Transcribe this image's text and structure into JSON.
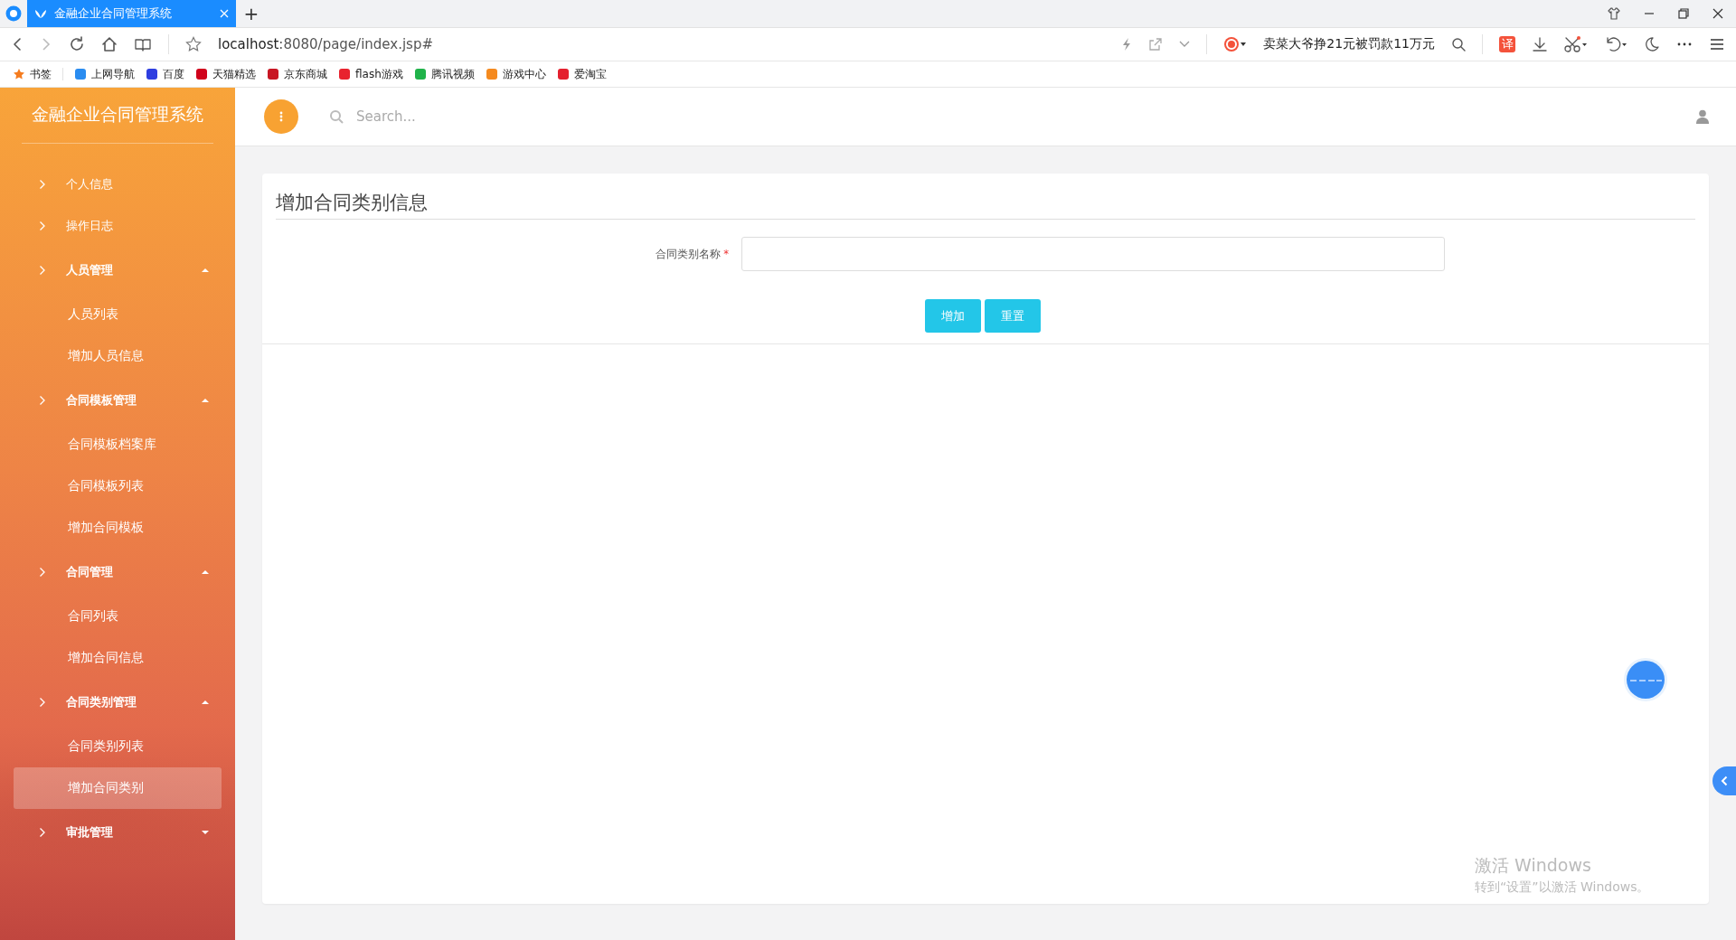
{
  "browser": {
    "tab": {
      "title": "金融企业合同管理系统",
      "selected": true
    },
    "new_tab": "+",
    "address": {
      "host": "localhost",
      "path": ":8080/page/index.jsp#"
    },
    "news": "卖菜大爷挣21元被罚款11万元",
    "translate": "译",
    "bookmarks": [
      {
        "label": "书签",
        "color": "#f57c1f"
      },
      {
        "label": "上网导航",
        "color": "#2a8cf0"
      },
      {
        "label": "百度",
        "color": "#2e3ee0"
      },
      {
        "label": "天猫精选",
        "color": "#d0021b"
      },
      {
        "label": "京东商城",
        "color": "#c81623"
      },
      {
        "label": "flash游戏",
        "color": "#e8232e"
      },
      {
        "label": "腾讯视频",
        "color": "#20b34a"
      },
      {
        "label": "游戏中心",
        "color": "#f58a1f"
      },
      {
        "label": "爱淘宝",
        "color": "#e4202e"
      }
    ]
  },
  "app": {
    "title": "金融企业合同管理系统",
    "search": {
      "placeholder": "Search..."
    }
  },
  "sidebar": {
    "items": [
      {
        "label": "个人信息",
        "kind": "link",
        "selected": false
      },
      {
        "label": "操作日志",
        "kind": "link",
        "selected": false
      },
      {
        "label": "人员管理",
        "kind": "group",
        "expanded": true,
        "children": [
          {
            "label": "人员列表",
            "selected": false
          },
          {
            "label": "增加人员信息",
            "selected": false
          }
        ]
      },
      {
        "label": "合同模板管理",
        "kind": "group",
        "expanded": true,
        "children": [
          {
            "label": "合同模板档案库",
            "selected": false
          },
          {
            "label": "合同模板列表",
            "selected": false
          },
          {
            "label": "增加合同模板",
            "selected": false
          }
        ]
      },
      {
        "label": "合同管理",
        "kind": "group",
        "expanded": true,
        "children": [
          {
            "label": "合同列表",
            "selected": false
          },
          {
            "label": "增加合同信息",
            "selected": false
          }
        ]
      },
      {
        "label": "合同类别管理",
        "kind": "group",
        "expanded": true,
        "children": [
          {
            "label": "合同类别列表",
            "selected": false
          },
          {
            "label": "增加合同类别",
            "selected": true
          }
        ]
      },
      {
        "label": "审批管理",
        "kind": "group",
        "expanded": false
      }
    ]
  },
  "form": {
    "title": "增加合同类别信息",
    "fields": [
      {
        "label": "合同类别名称",
        "required": true,
        "required_mark": "*"
      }
    ],
    "buttons": [
      "增加",
      "重置"
    ]
  },
  "os_notice": {
    "title": "激活 Windows",
    "subtitle": "转到“设置”以激活 Windows。"
  }
}
